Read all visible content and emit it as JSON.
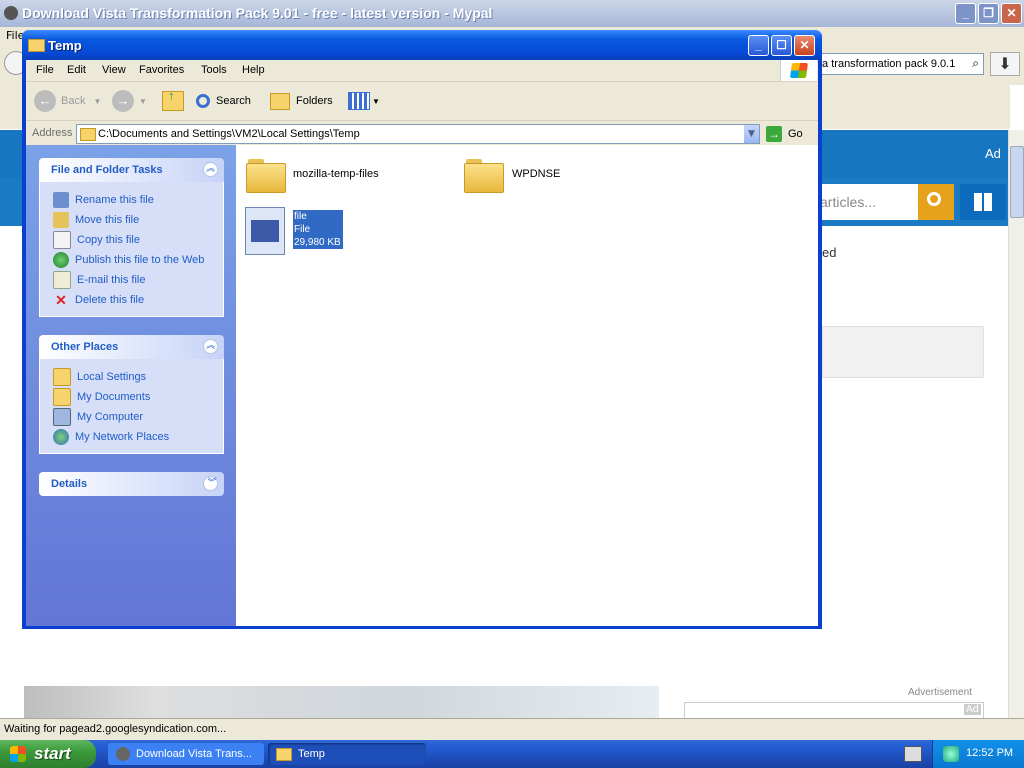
{
  "browser": {
    "title": "Download Vista Transformation Pack 9.01 - free - latest version - Mypal",
    "menu_partial": "File",
    "url_fragment": "ta transformation pack 9.0.1",
    "ad_label": "Ad",
    "search_placeholder": "articles...",
    "text_fragment": "ed",
    "advertisement_label": "Advertisement",
    "ad_corner": "Ad",
    "status_text": "Waiting for pagead2.googlesyndication.com..."
  },
  "explorer": {
    "title": "Temp",
    "menu": [
      "File",
      "Edit",
      "View",
      "Favorites",
      "Tools",
      "Help"
    ],
    "toolbar": {
      "back": "Back",
      "search": "Search",
      "folders": "Folders"
    },
    "address": {
      "label": "Address",
      "path": "C:\\Documents and Settings\\VM2\\Local Settings\\Temp",
      "go": "Go"
    },
    "tasks_panel": {
      "title": "File and Folder Tasks",
      "items": [
        {
          "label": "Rename this file",
          "icon": "rename-icon"
        },
        {
          "label": "Move this file",
          "icon": "move-icon"
        },
        {
          "label": "Copy this file",
          "icon": "copy-icon"
        },
        {
          "label": "Publish this file to the Web",
          "icon": "globe-icon"
        },
        {
          "label": "E-mail this file",
          "icon": "email-icon"
        },
        {
          "label": "Delete this file",
          "icon": "delete-icon"
        }
      ]
    },
    "places_panel": {
      "title": "Other Places",
      "items": [
        {
          "label": "Local Settings",
          "icon": "folder-icon"
        },
        {
          "label": "My Documents",
          "icon": "my-documents-icon"
        },
        {
          "label": "My Computer",
          "icon": "my-computer-icon"
        },
        {
          "label": "My Network Places",
          "icon": "network-icon"
        }
      ]
    },
    "details_panel": {
      "title": "Details"
    },
    "files": [
      {
        "name": "mozilla-temp-files",
        "type": "folder"
      },
      {
        "name": "WPDNSE",
        "type": "folder"
      }
    ],
    "selected_file": {
      "name": "file",
      "type": "File",
      "size": "29,980 KB"
    }
  },
  "taskbar": {
    "start": "start",
    "tasks": [
      {
        "label": "Download Vista Trans..."
      },
      {
        "label": "Temp"
      }
    ],
    "clock": "12:52 PM"
  },
  "colors": {
    "xp_blue": "#0a3fcf",
    "task_link": "#215dc6",
    "selection": "#316ac5"
  }
}
